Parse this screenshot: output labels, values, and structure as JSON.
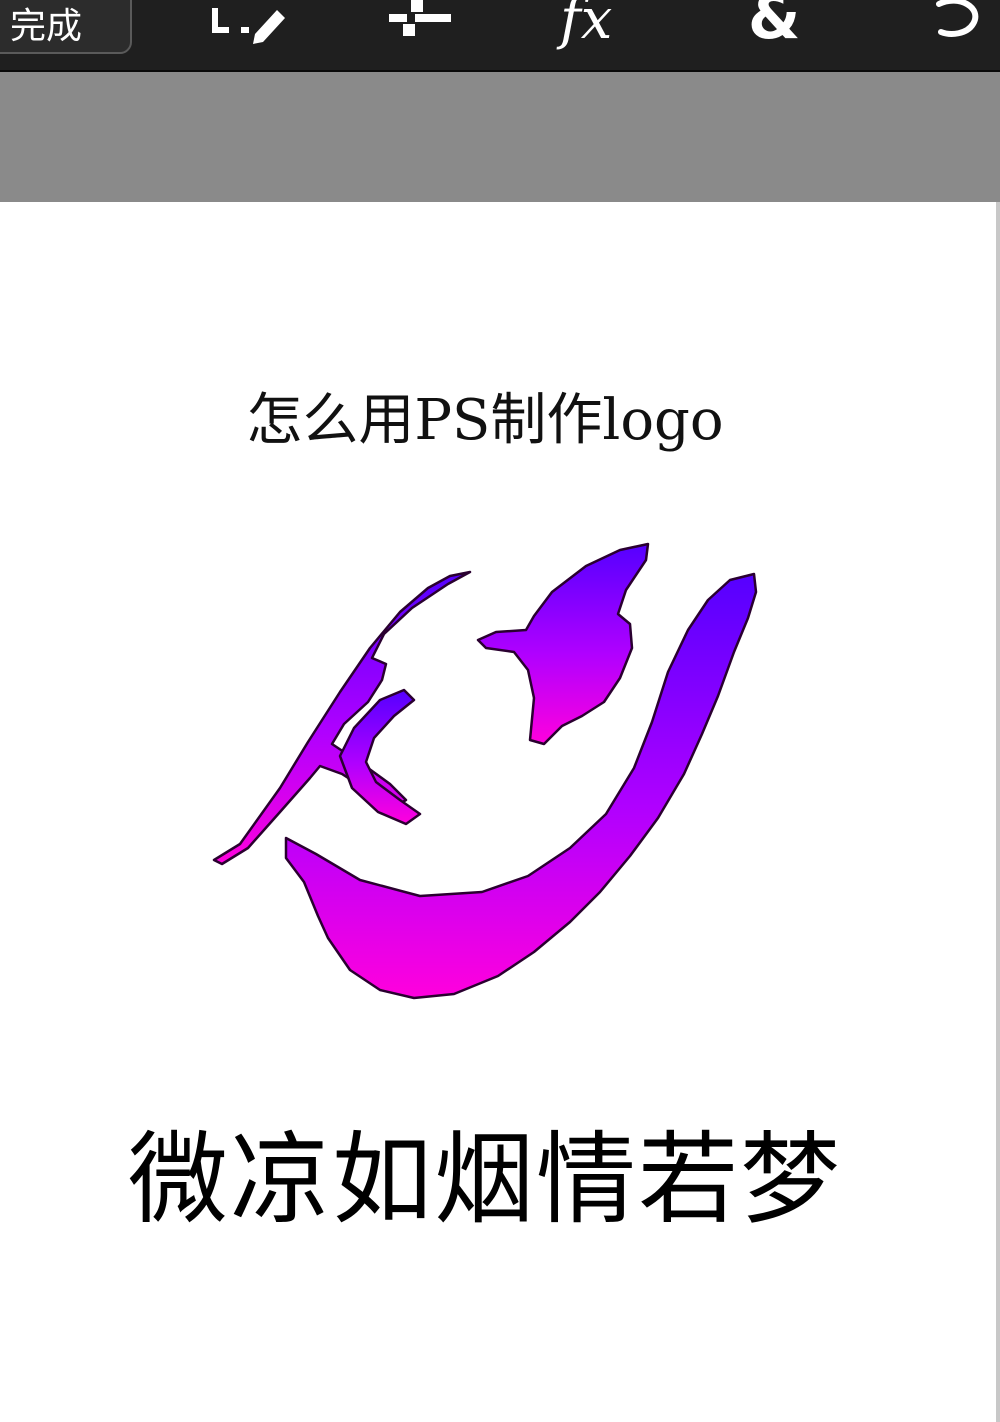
{
  "toolbar": {
    "done_label": "完成",
    "tools": [
      {
        "icon": "selection-edit-icon"
      },
      {
        "icon": "layers-adjust-icon"
      },
      {
        "icon": "fx-icon",
        "label": "fx"
      },
      {
        "icon": "ampersand-icon",
        "label": "&"
      },
      {
        "icon": "undo-icon"
      }
    ]
  },
  "canvas": {
    "title": "怎么用PS制作logo",
    "subtitle": "微凉如烟情若梦",
    "logo": {
      "letters": "KY",
      "gradient_top": "#5a00ff",
      "gradient_bottom": "#ff00dd"
    }
  },
  "colors": {
    "toolbar_bg": "#1f1f1f",
    "workspace_grey": "#8a8a8a",
    "canvas_bg": "#ffffff"
  }
}
